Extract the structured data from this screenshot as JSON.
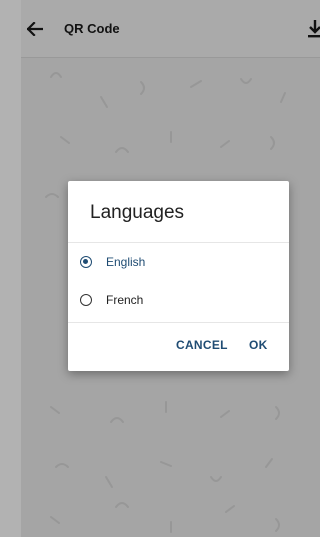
{
  "toolbar": {
    "title": "QR Code",
    "back_icon": "arrow-left-icon",
    "download_icon": "download-icon"
  },
  "dialog": {
    "title": "Languages",
    "options": [
      {
        "label": "English",
        "selected": true
      },
      {
        "label": "French",
        "selected": false
      }
    ],
    "cancel_label": "CANCEL",
    "ok_label": "OK"
  },
  "colors": {
    "accent": "#1f4c73",
    "background": "#ececec",
    "overlay": "rgba(0,0,0,0.30)"
  }
}
